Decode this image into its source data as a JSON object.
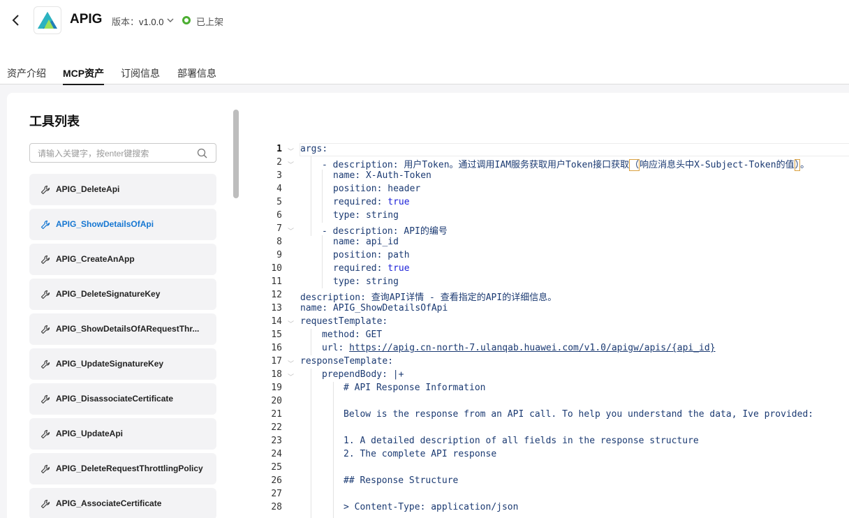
{
  "header": {
    "app_name": "APIG",
    "version_label": "版本：",
    "version_value": "v1.0.0",
    "status_text": "已上架",
    "status_color": "#4cae32"
  },
  "tabs": [
    {
      "label": "资产介绍",
      "active": false
    },
    {
      "label": "MCP资产",
      "active": true
    },
    {
      "label": "订阅信息",
      "active": false
    },
    {
      "label": "部署信息",
      "active": false
    }
  ],
  "tools": {
    "title": "工具列表",
    "search_placeholder": "请输入关键字，按enter键搜索",
    "items": [
      {
        "label": "APIG_DeleteApi",
        "selected": false
      },
      {
        "label": "APIG_ShowDetailsOfApi",
        "selected": true
      },
      {
        "label": "APIG_CreateAnApp",
        "selected": false
      },
      {
        "label": "APIG_DeleteSignatureKey",
        "selected": false
      },
      {
        "label": "APIG_ShowDetailsOfARequestThr...",
        "selected": false
      },
      {
        "label": "APIG_UpdateSignatureKey",
        "selected": false
      },
      {
        "label": "APIG_DisassociateCertificate",
        "selected": false
      },
      {
        "label": "APIG_UpdateApi",
        "selected": false
      },
      {
        "label": "APIG_DeleteRequestThrottlingPolicy",
        "selected": false
      },
      {
        "label": "APIG_AssociateCertificate",
        "selected": false
      }
    ]
  },
  "code": {
    "line_numbers": [
      "1",
      "2",
      "3",
      "4",
      "5",
      "6",
      "7",
      "8",
      "9",
      "10",
      "11",
      "12",
      "13",
      "14",
      "15",
      "16",
      "17",
      "18",
      "19",
      "20",
      "21",
      "22",
      "23",
      "24",
      "25",
      "26",
      "27",
      "28"
    ],
    "l1_key": "args",
    "l2_key": "description",
    "l2_val_a": "用户Token。通过调用IAM服务获取用户Token接口获取",
    "l2_paren_open": "（",
    "l2_val_b": "响应消息头中X-Subject-Token的值",
    "l2_paren_close": "）",
    "l2_val_c": "。",
    "l3_key": "name",
    "l3_val": "X-Auth-Token",
    "l4_key": "position",
    "l4_val": "header",
    "l5_key": "required",
    "l5_val": "true",
    "l6_key": "type",
    "l6_val": "string",
    "l7_key": "description",
    "l7_val": "API的编号",
    "l8_key": "name",
    "l8_val": "api_id",
    "l9_key": "position",
    "l9_val": "path",
    "l10_key": "required",
    "l10_val": "true",
    "l11_key": "type",
    "l11_val": "string",
    "l12_key": "description",
    "l12_val": "查询API详情 - 查看指定的API的详细信息。",
    "l13_key": "name",
    "l13_val": "APIG_ShowDetailsOfApi",
    "l14_key": "requestTemplate",
    "l15_key": "method",
    "l15_val": "GET",
    "l16_key": "url",
    "l16_val": "https://apig.cn-north-7.ulanqab.huawei.com/v1.0/apigw/apis/{api_id}",
    "l17_key": "responseTemplate",
    "l18_key": "prependBody",
    "l18_val": "|+",
    "l19": "# API Response Information",
    "l21": "Below is the response from an API call. To help you understand the data, Ive provided:",
    "l23": "1. A detailed description of all fields in the response structure",
    "l24": "2. The complete API response",
    "l26": "## Response Structure",
    "l28": "> Content-Type: application/json"
  }
}
